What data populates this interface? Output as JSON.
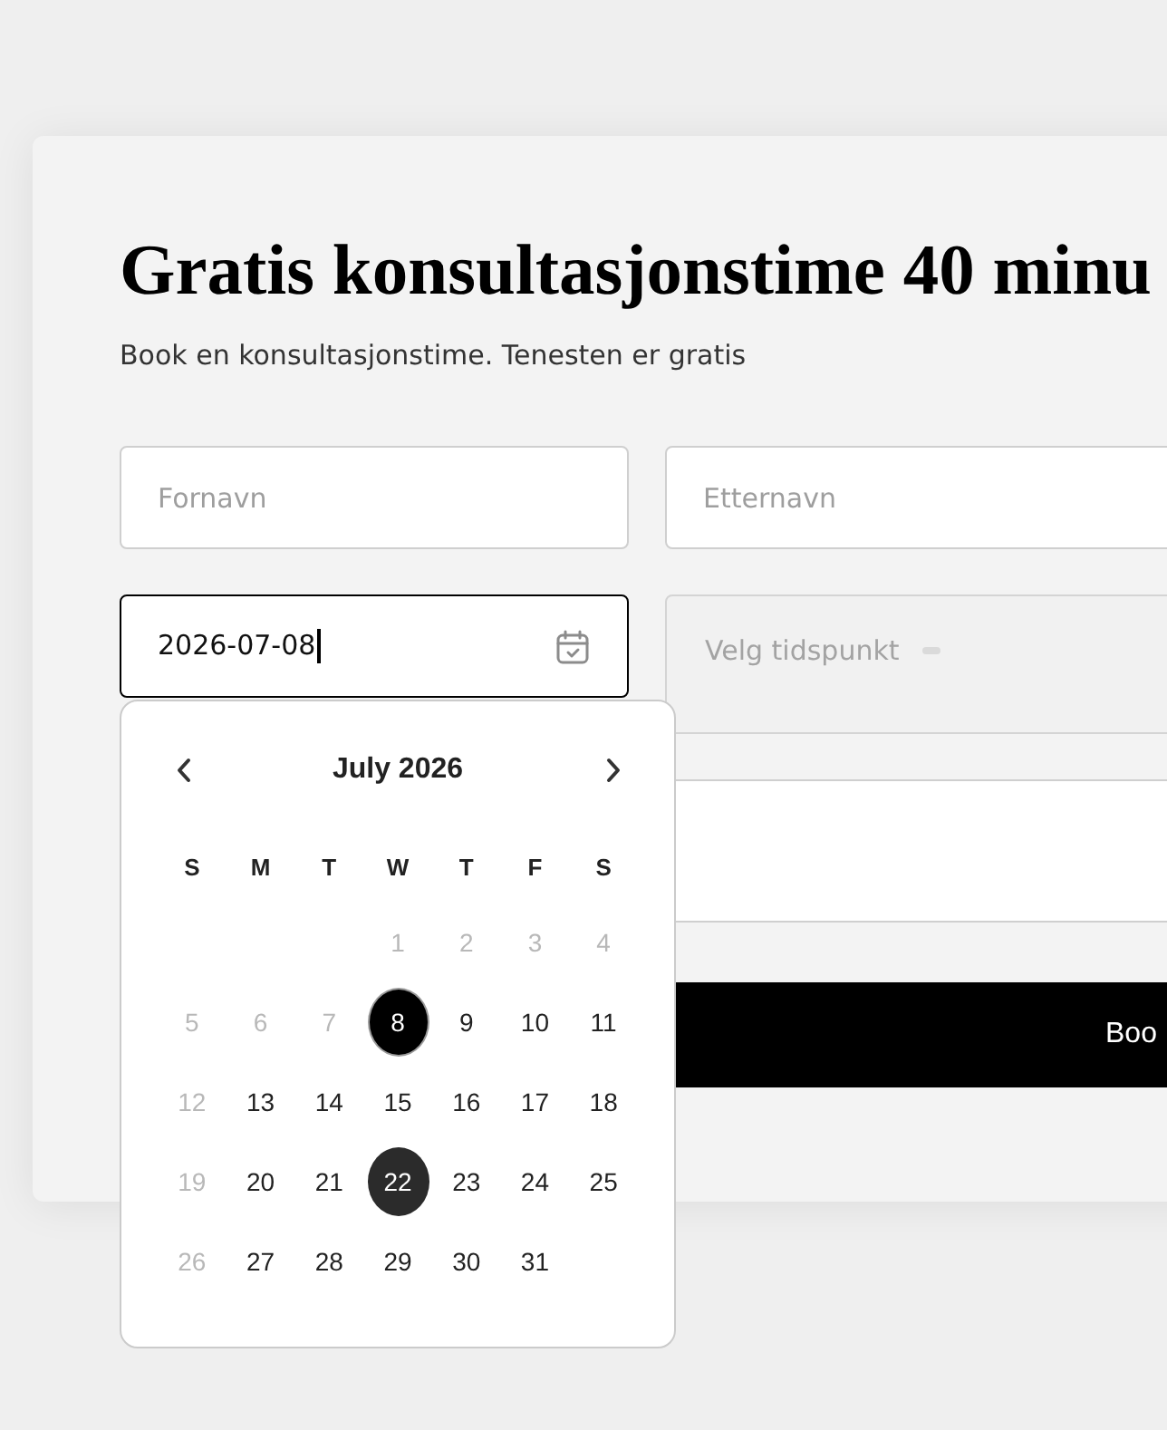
{
  "form": {
    "title": "Gratis konsultasjonstime 40 minu",
    "subtitle": "Book en konsultasjonstime. Tenesten er gratis",
    "first_name": {
      "placeholder": "Fornavn"
    },
    "last_name": {
      "placeholder": "Etternavn"
    },
    "date": {
      "value": "2026-07-08",
      "focused": true
    },
    "time": {
      "placeholder": "Velg tidspunkt",
      "disabled": true
    },
    "submit_button": {
      "label": "Boo"
    }
  },
  "date_picker": {
    "month": "July 2026",
    "weekdays": [
      "S",
      "M",
      "T",
      "W",
      "T",
      "F",
      "S"
    ],
    "weeks": [
      [
        {
          "label": "1",
          "disabled": true,
          "selected": false,
          "hovered": false
        },
        {
          "label": "2",
          "disabled": true,
          "selected": false,
          "hovered": false
        },
        {
          "label": "3",
          "disabled": true,
          "selected": false,
          "hovered": false
        },
        {
          "label": "4",
          "disabled": true,
          "selected": false,
          "hovered": false
        }
      ],
      [
        {
          "label": "5",
          "disabled": true,
          "selected": false,
          "hovered": false
        },
        {
          "label": "6",
          "disabled": true,
          "selected": false,
          "hovered": false
        },
        {
          "label": "7",
          "disabled": true,
          "selected": false,
          "hovered": false
        },
        {
          "label": "8",
          "disabled": false,
          "selected": true,
          "hovered": false
        },
        {
          "label": "9",
          "disabled": false,
          "selected": false,
          "hovered": false
        },
        {
          "label": "10",
          "disabled": false,
          "selected": false,
          "hovered": false
        },
        {
          "label": "11",
          "disabled": false,
          "selected": false,
          "hovered": false
        }
      ],
      [
        {
          "label": "12",
          "disabled": true,
          "selected": false,
          "hovered": false
        },
        {
          "label": "13",
          "disabled": false,
          "selected": false,
          "hovered": false
        },
        {
          "label": "14",
          "disabled": false,
          "selected": false,
          "hovered": false
        },
        {
          "label": "15",
          "disabled": false,
          "selected": false,
          "hovered": false
        },
        {
          "label": "16",
          "disabled": false,
          "selected": false,
          "hovered": false
        },
        {
          "label": "17",
          "disabled": false,
          "selected": false,
          "hovered": false
        },
        {
          "label": "18",
          "disabled": false,
          "selected": false,
          "hovered": false
        }
      ],
      [
        {
          "label": "19",
          "disabled": true,
          "selected": false,
          "hovered": false
        },
        {
          "label": "20",
          "disabled": false,
          "selected": false,
          "hovered": false
        },
        {
          "label": "21",
          "disabled": false,
          "selected": false,
          "hovered": false
        },
        {
          "label": "22",
          "disabled": false,
          "selected": false,
          "hovered": true
        },
        {
          "label": "23",
          "disabled": false,
          "selected": false,
          "hovered": false
        },
        {
          "label": "24",
          "disabled": false,
          "selected": false,
          "hovered": false
        },
        {
          "label": "25",
          "disabled": false,
          "selected": false,
          "hovered": false
        }
      ],
      [
        {
          "label": "26",
          "disabled": true,
          "selected": false,
          "hovered": false
        },
        {
          "label": "27",
          "disabled": false,
          "selected": false,
          "hovered": false
        },
        {
          "label": "28",
          "disabled": false,
          "selected": false,
          "hovered": false
        },
        {
          "label": "29",
          "disabled": false,
          "selected": false,
          "hovered": false
        },
        {
          "label": "30",
          "disabled": false,
          "selected": false,
          "hovered": false
        },
        {
          "label": "31",
          "disabled": false,
          "selected": false,
          "hovered": false
        }
      ]
    ]
  }
}
